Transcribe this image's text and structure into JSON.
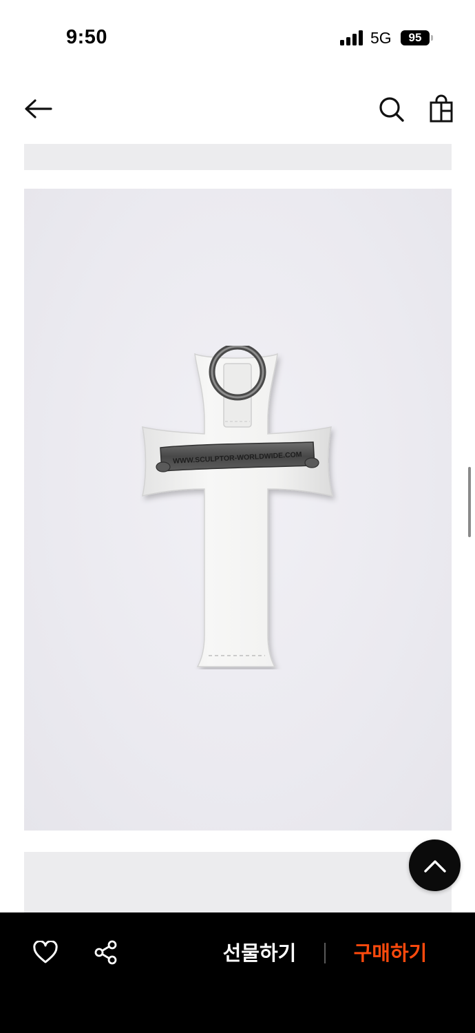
{
  "status_bar": {
    "time": "9:50",
    "network": "5G",
    "battery": "95"
  },
  "nav": {
    "back_icon": "arrow-left-icon",
    "search_icon": "search-icon",
    "bag_icon": "shopping-bag-icon"
  },
  "product": {
    "image_subject": "white pony-hair cross keyring with metal ring",
    "engraving": "WWW.SCULPTOR-WORLDWIDE.COM"
  },
  "scroll_top_icon": "chevron-up-icon",
  "action_bar": {
    "like_icon": "heart-icon",
    "share_icon": "share-icon",
    "gift_label": "선물하기",
    "buy_label": "구매하기",
    "buy_color": "#ff4a0d"
  }
}
